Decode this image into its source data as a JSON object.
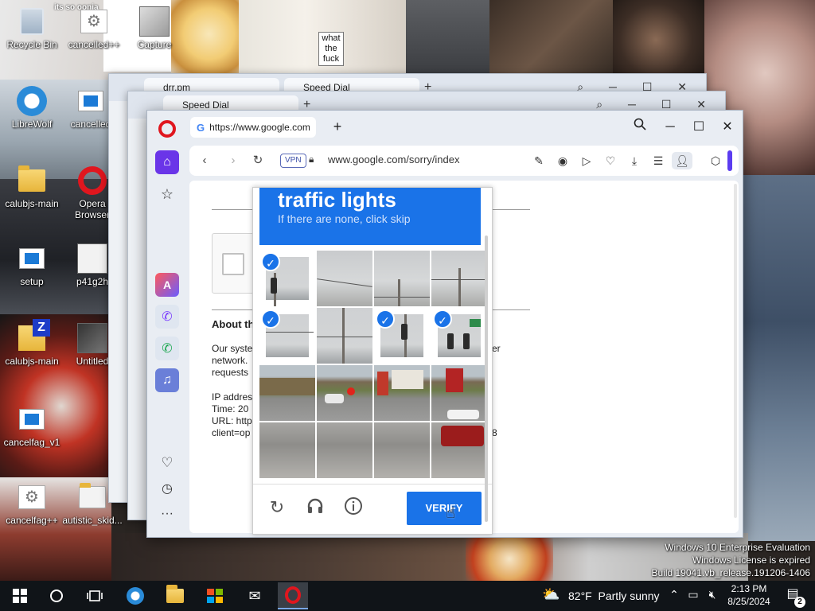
{
  "desktop": {
    "icons": [
      {
        "label": "Recycle Bin",
        "icon": "recycle-bin-icon"
      },
      {
        "label": "cancelled++",
        "icon": "gears-icon"
      },
      {
        "label": "Capture",
        "icon": "image-file-icon"
      },
      {
        "label": "LibreWolf",
        "icon": "librewolf-icon"
      },
      {
        "label": "cancelled",
        "icon": "app-icon"
      },
      {
        "label": "calubjs-main",
        "icon": "folder-icon"
      },
      {
        "label": "Opera Browser",
        "icon": "opera-icon"
      },
      {
        "label": "setup",
        "icon": "setup-icon"
      },
      {
        "label": "p41g2h",
        "icon": "image-file-icon"
      },
      {
        "label": "calubjs-main",
        "icon": "zip-folder-icon"
      },
      {
        "label": "Untitled",
        "icon": "image-file-icon"
      },
      {
        "label": "cancelfag_v1",
        "icon": "app-icon"
      },
      {
        "label": "cancelfag++",
        "icon": "gears-icon"
      },
      {
        "label": "autistic_skid...",
        "icon": "file-icon"
      }
    ],
    "wallpaper_texts": {
      "top_left": "its so oonia",
      "sign": "what the fuck"
    }
  },
  "background_windows": [
    {
      "tabs": [
        "drr.pm",
        "Speed Dial"
      ]
    },
    {
      "tabs": [
        "Speed Dial"
      ]
    }
  ],
  "browser": {
    "tab_title": "https://www.google.com/",
    "url": "www.google.com/sorry/index",
    "vpn_label": "VPN",
    "window_buttons": [
      "search-icon",
      "minimize-icon",
      "maximize-icon",
      "close-icon"
    ],
    "accent_color": "#6a35e8"
  },
  "page": {
    "about_title": "About th",
    "paragraph_lines": [
      "Our syste",
      "network.",
      "requests"
    ],
    "paragraph_right": "er",
    "info_lines": [
      "IP addres",
      "Time: 20",
      "URL: http",
      "client=op"
    ],
    "info_right": "8"
  },
  "captcha": {
    "title": "traffic lights",
    "subtitle": "If there are none, click skip",
    "verify_label": "VERIFY",
    "grid": {
      "rows": 4,
      "cols": 4,
      "selected": [
        0,
        4,
        6,
        7
      ]
    },
    "brand_color": "#1a73e8"
  },
  "watermark": {
    "line1": "Windows 10 Enterprise Evaluation",
    "line2": "Windows License is expired",
    "line3": "Build 19041.vb_release.191206-1406"
  },
  "taskbar": {
    "apps": [
      "start-icon",
      "search-icon",
      "task-view-icon",
      "librewolf-icon",
      "file-explorer-icon",
      "store-icon",
      "mail-icon",
      "opera-icon"
    ],
    "weather_temp": "82°F",
    "weather_text": "Partly sunny",
    "time": "2:13 PM",
    "date": "8/25/2024",
    "notifications": "2"
  }
}
